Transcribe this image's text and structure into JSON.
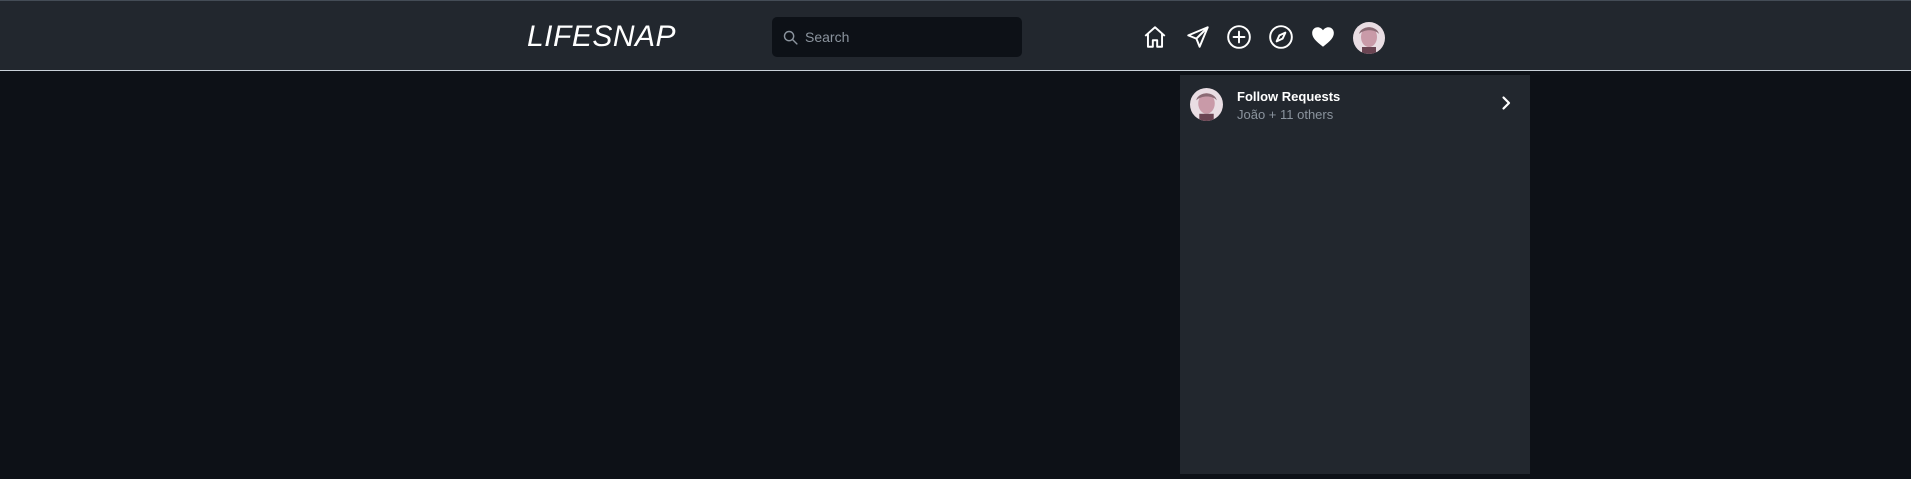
{
  "header": {
    "logo": "LIFESNAP",
    "search": {
      "placeholder": "Search",
      "value": ""
    },
    "nav_icons": [
      "home-icon",
      "send-icon",
      "add-post-icon",
      "explore-icon",
      "notifications-heart-icon",
      "profile-avatar"
    ]
  },
  "notifications_panel": {
    "follow_requests": {
      "title": "Follow Requests",
      "subtitle": "João + 11 others"
    }
  },
  "colors": {
    "background": "#0d1117",
    "bar": "#22272e",
    "panel": "#22272e",
    "text_primary": "#ffffff",
    "text_muted": "#8b949e"
  }
}
